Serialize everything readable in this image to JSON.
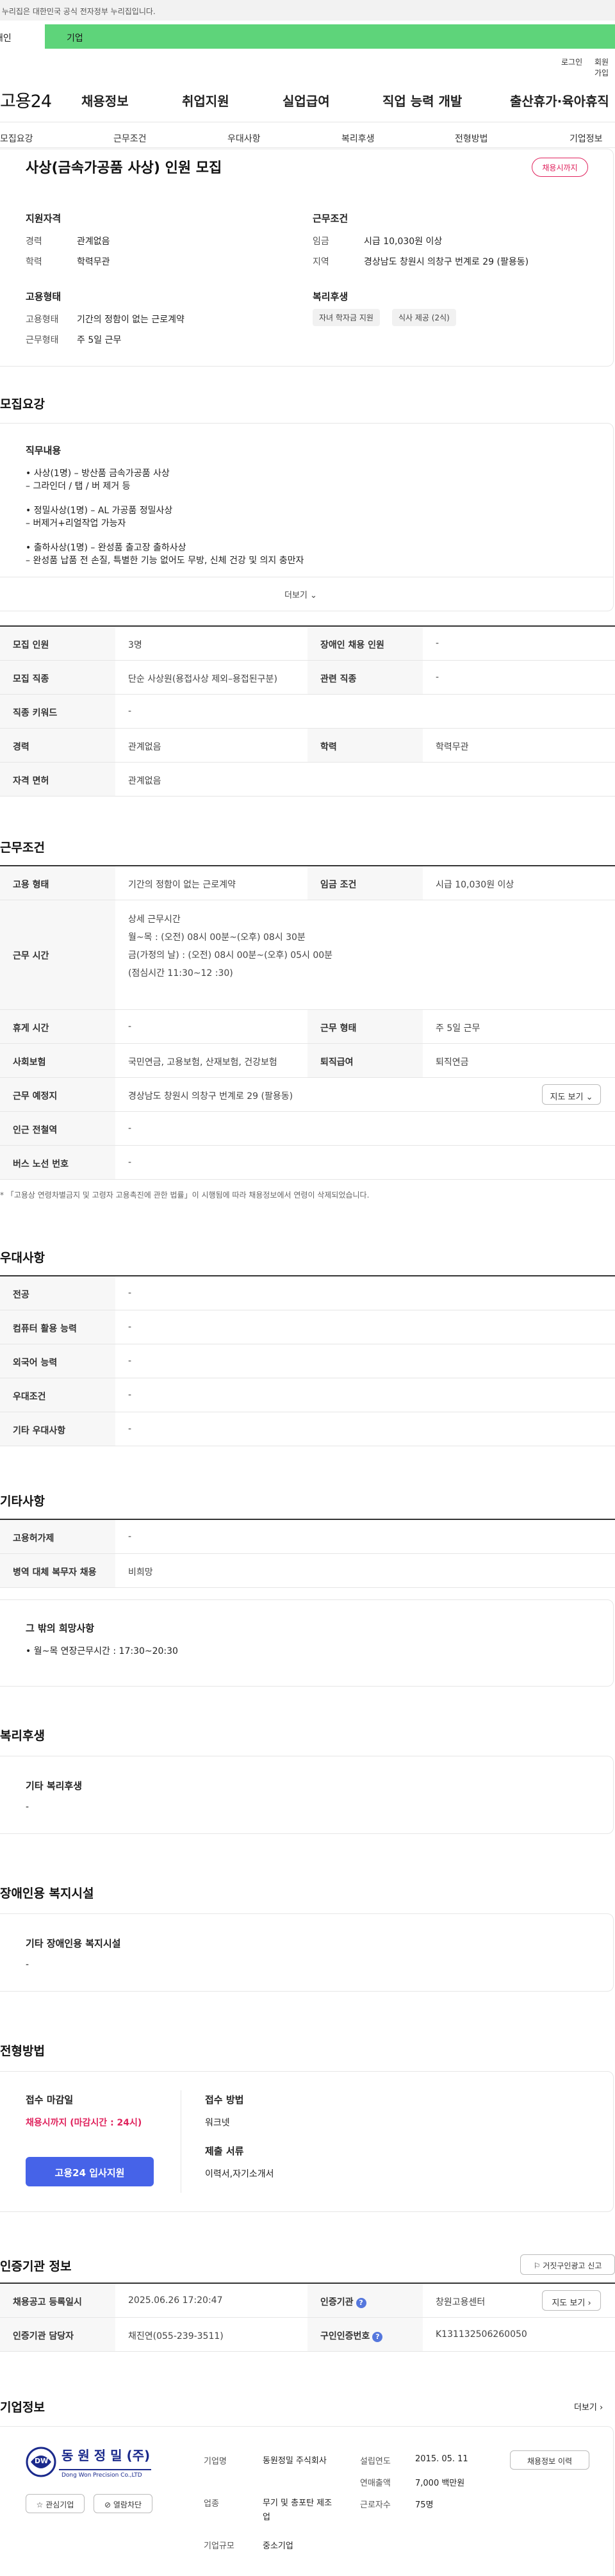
{
  "gov_bar": "이 누리집은 대한민국 공식 전자정부 누리집입니다.",
  "member_tabs": {
    "personal": "개인",
    "company": "기업"
  },
  "util_links": [
    "로그인",
    "회원가입"
  ],
  "header": {
    "logo": "고용24",
    "nav": [
      "채용정보",
      "취업지원",
      "실업급여",
      "직업 능력 개발",
      "출산휴가·육아휴직"
    ]
  },
  "subnav": [
    "모집요강",
    "근무조건",
    "우대사항",
    "복리후생",
    "전형방법",
    "기업정보"
  ],
  "summary": {
    "title": "사상(금속가공품 사상) 인원 모집",
    "status_badge": "채용시까지",
    "qualification": {
      "heading": "지원자격",
      "career_label": "경력",
      "career_value": "관계없음",
      "edu_label": "학력",
      "edu_value": "학력무관"
    },
    "conditions": {
      "heading": "근무조건",
      "wage_label": "임금",
      "wage_value": "시급 10,030원 이상",
      "region_label": "지역",
      "region_value": "경상남도 창원시 의창구 번계로 29 (팔용동)"
    },
    "employment": {
      "heading": "고용형태",
      "type_label": "고용형태",
      "type_value": "기간의 정함이 없는 근로계약",
      "work_label": "근무형태",
      "work_value": "주 5일 근무"
    },
    "welfare": {
      "heading": "복리후생",
      "chips": [
        "자녀 학자금 지원",
        "식사 제공 (2식)"
      ]
    }
  },
  "recruit": {
    "heading": "모집요강",
    "duty_heading": "직무내용",
    "duties": [
      "• 사상(1명) –  방산품 금속가공품 사상",
      "  – 그라인더 / 탭 / 버 제거 등",
      "• 정밀사상(1명) – AL 가공품 정밀사상",
      "  – 버제거+리얼작업 가능자",
      "• 출하사상(1명) – 완성품 출고장 출하사상",
      "  – 완성품 납품 전 손질, 특별한 기능 없어도 무방, 신체 건강 및 의지 충만자"
    ],
    "more": "더보기",
    "table": [
      {
        "k1": "모집 인원",
        "v1": "3명",
        "k2": "장애인 채용 인원",
        "v2": "-"
      },
      {
        "k1": "모집 직종",
        "v1": "단순 사상원(용접사상 제외–용접된구분)",
        "k2": "관련 직종",
        "v2": "-"
      },
      {
        "k1": "직종 키워드",
        "v1": "-",
        "k2": "",
        "v2": ""
      },
      {
        "k1": "경력",
        "v1": "관계없음",
        "k2": "학력",
        "v2": "학력무관"
      },
      {
        "k1": "자격 면허",
        "v1": "관계없음",
        "k2": "",
        "v2": ""
      }
    ]
  },
  "work": {
    "heading": "근무조건",
    "type_k": "고용 형태",
    "type_v": "기간의 정함이 없는 근로계약",
    "wage_k": "임금 조건",
    "wage_v": "시급 10,030원 이상",
    "hours_k": "근무 시간",
    "hours_lines": [
      "상세 근무시간",
      "월~목 : (오전) 08시 00분~(오후) 08시 30분",
      "금(가정의 날) : (오전) 08시 00분~(오후) 05시 00분",
      "(점심시간  11:30~12 :30)"
    ],
    "rest_k": "휴게 시간",
    "rest_v": "-",
    "form_k": "근무 형태",
    "form_v": "주 5일 근무",
    "ins_k": "사회보험",
    "ins_v": "국민연금, 고용보험, 산재보험, 건강보험",
    "ret_k": "퇴직급여",
    "ret_v": "퇴직연금",
    "place_k": "근무 예정지",
    "place_v": "경상남도 창원시 의창구 번계로 29 (팔용동)",
    "map_btn": "지도 보기",
    "subway_k": "인근 전철역",
    "subway_v": "-",
    "bus_k": "버스 노선 번호",
    "bus_v": "-",
    "note": "* 「고용상 연령차별금지 및 고령자 고용촉진에 관한 법률」이 시행됨에 따라 채용정보에서 연령이 삭제되었습니다."
  },
  "pref": {
    "heading": "우대사항",
    "rows": [
      {
        "k": "전공",
        "v": "-"
      },
      {
        "k": "컴퓨터 활용 능력",
        "v": "-"
      },
      {
        "k": "외국어 능력",
        "v": "-"
      },
      {
        "k": "우대조건",
        "v": "-"
      },
      {
        "k": "기타 우대사항",
        "v": "-"
      }
    ]
  },
  "etc": {
    "heading": "기타사항",
    "rows": [
      {
        "k": "고용허가제",
        "v": "-"
      },
      {
        "k": "병역 대체 복무자 채용",
        "v": "비희망"
      }
    ],
    "extra_heading": "그 밖의 희망사항",
    "extra_value": "• 월~목 연장근무시간 : 17:30~20:30"
  },
  "welfare": {
    "heading": "복리후생",
    "sub": "기타 복리후생",
    "value": "-"
  },
  "disabled": {
    "heading": "장애인용 복지시설",
    "sub": "기타 장애인용 복지시설",
    "value": "-"
  },
  "selection": {
    "heading": "전형방법",
    "deadline_label": "접수 마감일",
    "deadline_value": "채용시까지 (마감시간 : 24시)",
    "apply_btn": "고용24 입사지원",
    "method_label": "접수 방법",
    "method_value": "워크넷",
    "docs_label": "제출 서류",
    "docs_value": "이력서,자기소개서"
  },
  "cert": {
    "heading": "인증기관 정보",
    "report_btn": "거짓구인광고 신고",
    "reg_k": "채용공고 등록일시",
    "reg_v": "2025.06.26 17:20:47",
    "agency_k": "인증기관",
    "agency_v": "창원고용센터",
    "map_btn": "지도 보기",
    "staff_k": "인증기관 담당자",
    "staff_v": "채진연(055-239-3511)",
    "num_k": "구인인증번호",
    "num_v": "K131132506260050"
  },
  "company": {
    "heading": "기업정보",
    "more": "더보기",
    "logo_text": "동 원 정 밀 (주)",
    "logo_sub": "Dong Won Precision Co.,LTD",
    "logo_mark": "DW",
    "fav_btn": "관심기업",
    "block_btn": "열람차단",
    "name_k": "기업명",
    "name_v": "동원정밀 주식회사",
    "industry_k": "업종",
    "industry_v": "무기 및 총포탄 제조업",
    "size_k": "기업규모",
    "size_v": "중소기업",
    "est_k": "설립연도",
    "est_v": "2015. 05. 11",
    "sales_k": "연매출액",
    "sales_v": "7,000 백만원",
    "emp_k": "근로자수",
    "emp_v": "75명",
    "jobs_btn": "채용정보 이력"
  }
}
